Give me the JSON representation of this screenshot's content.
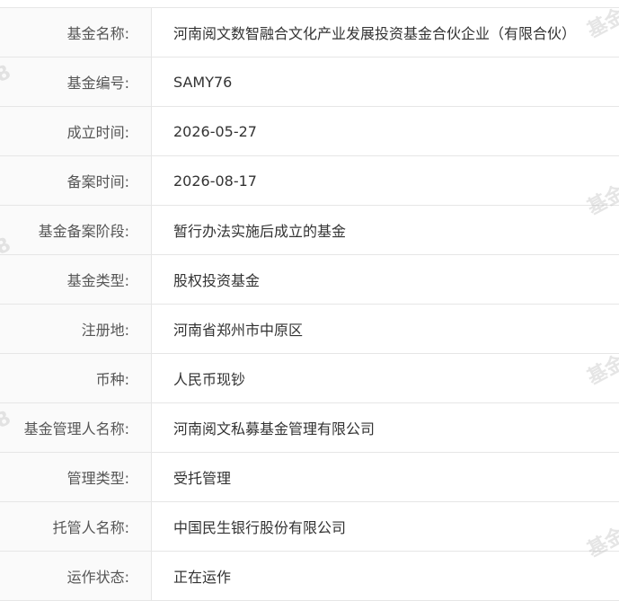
{
  "fund_info": {
    "rows": [
      {
        "label": "基金名称:",
        "value": "河南阅文数智融合文化产业发展投资基金合伙企业（有限合伙）"
      },
      {
        "label": "基金编号:",
        "value": "SAMY76"
      },
      {
        "label": "成立时间:",
        "value": "2026-05-27"
      },
      {
        "label": "备案时间:",
        "value": "2026-08-17"
      },
      {
        "label": "基金备案阶段:",
        "value": "暂行办法实施后成立的基金"
      },
      {
        "label": "基金类型:",
        "value": "股权投资基金"
      },
      {
        "label": "注册地:",
        "value": "河南省郑州市中原区"
      },
      {
        "label": "币种:",
        "value": "人民币现钞"
      },
      {
        "label": "基金管理人名称:",
        "value": "河南阅文私募基金管理有限公司"
      },
      {
        "label": "管理类型:",
        "value": "受托管理"
      },
      {
        "label": "托管人名称:",
        "value": "中国民生银行股份有限公司"
      },
      {
        "label": "运作状态:",
        "value": "正在运作"
      }
    ]
  },
  "watermark": {
    "text": "基金",
    "fragment": "8"
  }
}
